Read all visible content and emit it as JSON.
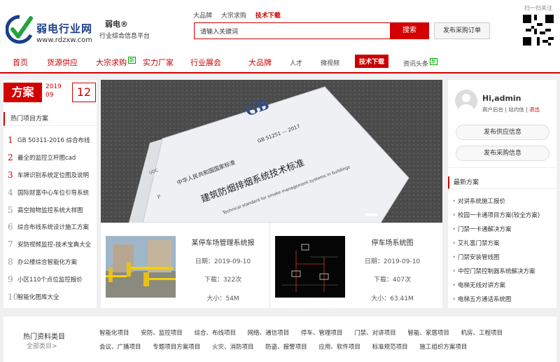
{
  "logo": {
    "name": "弱电行业网",
    "url": "www.rdzxw.com"
  },
  "slogan": {
    "brand": "弱电®",
    "tagline": "行业综合信息平台"
  },
  "search_tabs": [
    {
      "label": "大品牌",
      "active": false
    },
    {
      "label": "大宗求购",
      "active": false
    },
    {
      "label": "技术下载",
      "active": true
    }
  ],
  "search": {
    "placeholder": "请输入关键词",
    "button": "搜索",
    "publish_button": "发布采购订单"
  },
  "qr": {
    "label": "扫一扫关注"
  },
  "nav": [
    {
      "label": "首页",
      "style": "red"
    },
    {
      "label": "货源供应",
      "style": "red"
    },
    {
      "label": "大宗求购",
      "style": "red",
      "badge": "新"
    },
    {
      "label": "实力厂家",
      "style": "red"
    },
    {
      "label": "行业展会",
      "style": "red"
    },
    {
      "label": "大品牌",
      "style": "red"
    },
    {
      "label": "人才",
      "style": "gray"
    },
    {
      "label": "微视频",
      "style": "gray"
    },
    {
      "label": "技术下载",
      "style": "active"
    },
    {
      "label": "资讯头条",
      "style": "gray",
      "badge": "新"
    }
  ],
  "fangan": {
    "label": "方案",
    "year": "2019",
    "month": "09",
    "day": "12"
  },
  "hot": {
    "heading": "热门项目方案",
    "items": [
      {
        "num": "1",
        "text": "GB 50311-2016 综合布线"
      },
      {
        "num": "2",
        "text": "最全的监控立杆图cad"
      },
      {
        "num": "3",
        "text": "车牌识别系统定位图及说明"
      },
      {
        "num": "4",
        "text": "国际财富中心车位引导系统"
      },
      {
        "num": "5",
        "text": "高空抛物监控系统大样图"
      },
      {
        "num": "6",
        "text": "综合布线系统设计施工方案"
      },
      {
        "num": "7",
        "text": "安防视频监控-技术宝典大全"
      },
      {
        "num": "8",
        "text": "办公楼综合智能化方案"
      },
      {
        "num": "9",
        "text": "小区110个点位监控报价"
      },
      {
        "num": "10",
        "text": "智能化图库大全"
      }
    ]
  },
  "banner": {
    "alt": "GB 51251-2017 建筑防烟排烟系统技术标准",
    "gb": "GB",
    "std_no": "GB 51251 — 2017",
    "cn_org": "中华人民共和国国家标准",
    "cn_title": "建筑防烟排烟系统技术标准",
    "en_title": "Technical standard for smoke management systems in buildings",
    "udc": "UDC",
    "p": "P"
  },
  "cards": [
    {
      "title": "某停车场管理系统报",
      "date": "日期：2019-09-10",
      "downloads": "下载：322次",
      "size": "大小：54M"
    },
    {
      "title": "停车场系统图",
      "date": "日期：2019-09-10",
      "downloads": "下载：407次",
      "size": "大小：63.41M"
    }
  ],
  "user": {
    "greeting": "Hi,admin",
    "backend": "商户后台",
    "inbox": "站内信",
    "logout": "退出",
    "supply_button": "发布供应信息",
    "purchase_button": "发布采购信息"
  },
  "latest": {
    "heading": "最新方案",
    "items": [
      "对讲系统施工报价",
      "校园一卡通项目方案(较全方案)",
      "门禁一卡通解决方案",
      "艾礼富门禁方案",
      "门禁安装管线图",
      "中控门禁控制器系统解决方案",
      "电梯无线对讲方案",
      "电梯五方通话系统图"
    ]
  },
  "categories": {
    "heading": "热门资料类目",
    "all": "全部类目>",
    "row1": [
      "智能化项目",
      "安防、监控项目",
      "综合、布线项目",
      "网络、通信项目",
      "停车、管理项目",
      "门禁、对讲项目",
      "智能、家居项目",
      "机房、工程项目"
    ],
    "row2": [
      "会议、广播项目",
      "专题项目方案项目",
      "火灾、消防项目",
      "防盗、报警项目",
      "应用、软件项目",
      "标准规范项目",
      "施工组织方案项目"
    ]
  },
  "colors": {
    "brand_red": "#d40000",
    "logo_blue": "#1a3f8a",
    "logo_green": "#27a243"
  }
}
